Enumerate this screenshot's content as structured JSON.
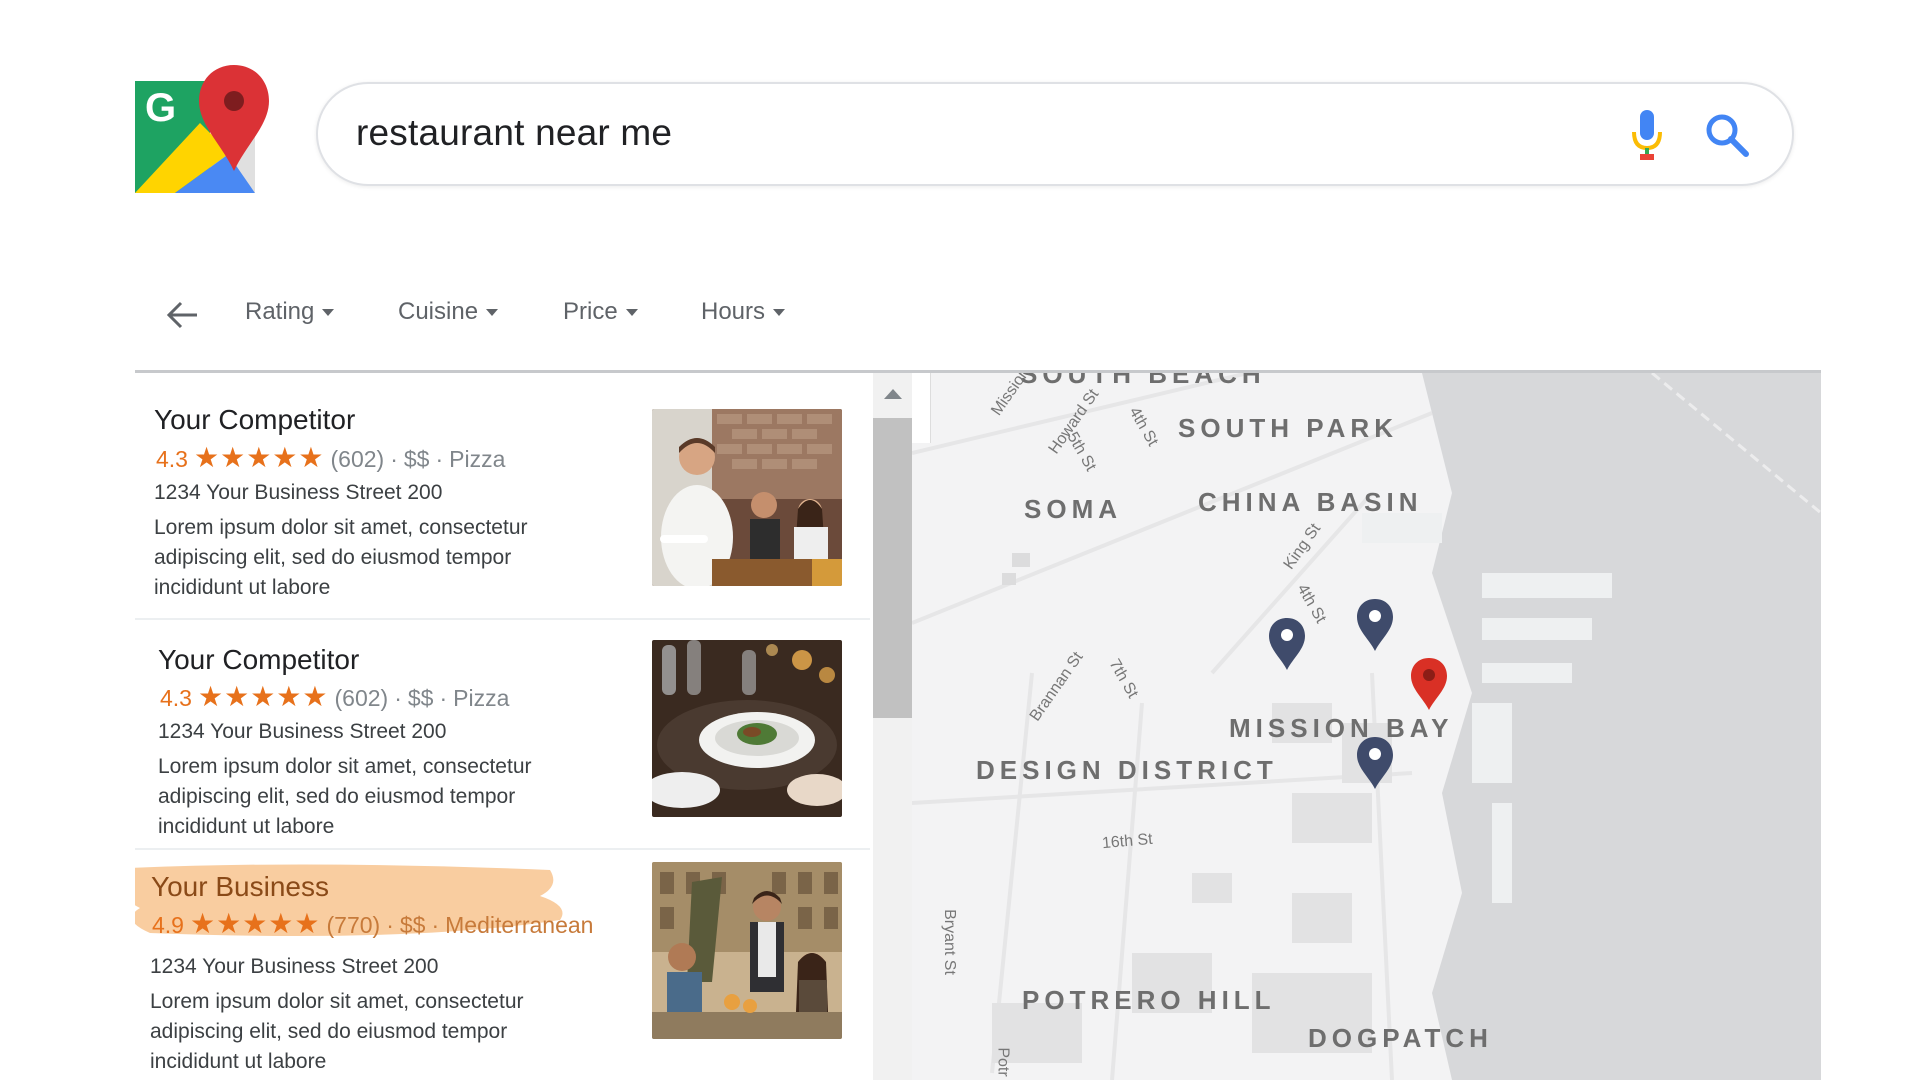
{
  "search": {
    "query": "restaurant near me"
  },
  "filters": [
    {
      "label": "Rating"
    },
    {
      "label": "Cuisine"
    },
    {
      "label": "Price"
    },
    {
      "label": "Hours"
    }
  ],
  "results": [
    {
      "name": "Your Competitor",
      "rating": "4.3",
      "stars": "★★★★★",
      "reviews": "(602)",
      "price": "$$",
      "category": "Pizza",
      "address": "1234 Your Business Street 200",
      "description": "Lorem ipsum dolor sit amet, consectetur adipiscing elit, sed do eiusmod tempor incididunt ut labore",
      "photo": "waiter-restaurant-photo"
    },
    {
      "name": "Your Competitor",
      "rating": "4.3",
      "stars": "★★★★★",
      "reviews": "(602)",
      "price": "$$",
      "category": "Pizza",
      "address": "1234 Your Business Street 200",
      "description": "Lorem ipsum dolor sit amet, consectetur adipiscing elit, sed do eiusmod tempor incididunt ut labore",
      "photo": "plated-dish-photo"
    },
    {
      "name": "Your Business",
      "rating": "4.9",
      "stars": "★★★★★",
      "reviews": "(770)",
      "price": "$$",
      "category": "Mediterranean",
      "address": "1234 Your Business Street 200",
      "description": "Lorem ipsum dolor sit amet, consectetur adipiscing elit, sed do eiusmod tempor incididunt ut labore",
      "photo": "outdoor-dining-photo",
      "highlighted": true
    }
  ],
  "map": {
    "districts": [
      "SOUTH PARK",
      "SOMA",
      "CHINA BASIN",
      "MISSION BAY",
      "DESIGN DISTRICT",
      "POTRERO HILL",
      "DOGPATCH",
      "SOUTH BEACH"
    ],
    "streets": [
      "Howard St",
      "5th St",
      "4th St",
      "King St",
      "4th St",
      "Brannan St",
      "7th St",
      "16th St",
      "Bryant St",
      "Mission",
      "Potr"
    ],
    "pin_colors": {
      "competitor": "#3f4b6b",
      "your_business": "#d93025"
    }
  },
  "colors": {
    "accent_orange": "#e7711b",
    "highlight": "#f8c48f"
  }
}
